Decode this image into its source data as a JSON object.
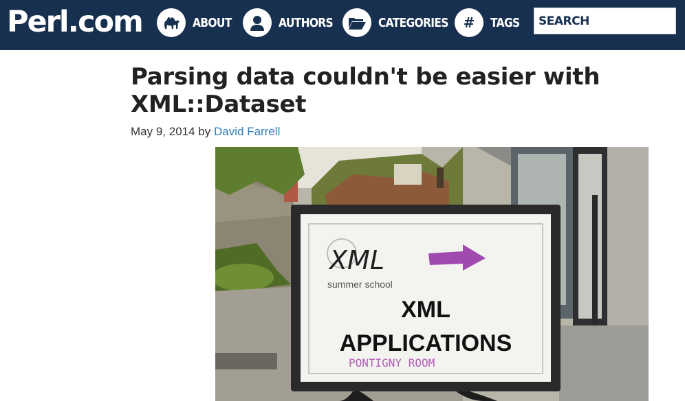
{
  "site": {
    "logo": "Perl.com"
  },
  "nav": {
    "items": [
      {
        "label": "ABOUT",
        "icon": "camel-icon"
      },
      {
        "label": "AUTHORS",
        "icon": "user-icon"
      },
      {
        "label": "CATEGORIES",
        "icon": "folder-open-icon"
      },
      {
        "label": "TAGS",
        "icon": "hash-icon"
      }
    ],
    "search_placeholder": "SEARCH"
  },
  "article": {
    "title": "Parsing data couldn't be easier with XML::Dataset",
    "date": "May 9, 2014",
    "by": "by",
    "author": "David Farrell",
    "image": {
      "sign_logo": "XML",
      "sign_subtitle": "summer school",
      "sign_line1": "XML",
      "sign_line2": "APPLICATIONS",
      "sign_room": "PONTIGNY ROOM"
    }
  },
  "colors": {
    "header_bg": "#17304f",
    "link": "#2f7fbd",
    "title_text": "#222222"
  }
}
